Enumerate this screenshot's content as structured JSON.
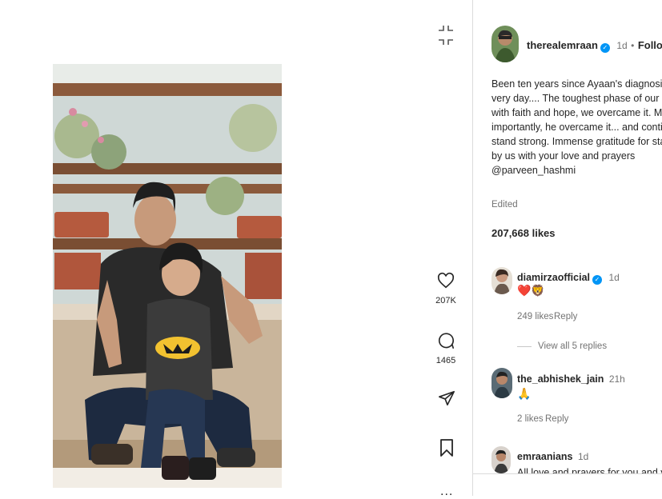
{
  "post": {
    "photo_alt": "Father and son seated on the floor"
  },
  "actions": {
    "like_count": "207K",
    "comment_count": "1465"
  },
  "author": {
    "username": "therealemraan",
    "time": "1d",
    "separator": "•",
    "follow_state": "Following"
  },
  "caption": {
    "lines": [
      "Been ten years since Ayaan's diagnosis on th",
      "very day.... The toughest phase of our lives, t",
      "with faith and hope, we overcame it. More",
      "importantly, he overcame it... and continues",
      "stand strong. Immense gratitude for standin",
      "by us with your love and prayers",
      "@parveen_hashmi"
    ],
    "edited_label": "Edited"
  },
  "likes_text": "207,668 likes",
  "comments": [
    {
      "username": "diamirzaofficial",
      "verified": true,
      "time": "1d",
      "text": "❤️🦁",
      "likes": "249 likes",
      "reply": "Reply",
      "view_replies": "View all 5 replies"
    },
    {
      "username": "the_abhishek_jain",
      "verified": false,
      "time": "21h",
      "text": "🙏",
      "likes": "2 likes",
      "reply": "Reply"
    },
    {
      "username": "emraanians",
      "verified": false,
      "time": "1d",
      "text": "All love and prayers for you and your"
    }
  ],
  "more_dots": "..."
}
